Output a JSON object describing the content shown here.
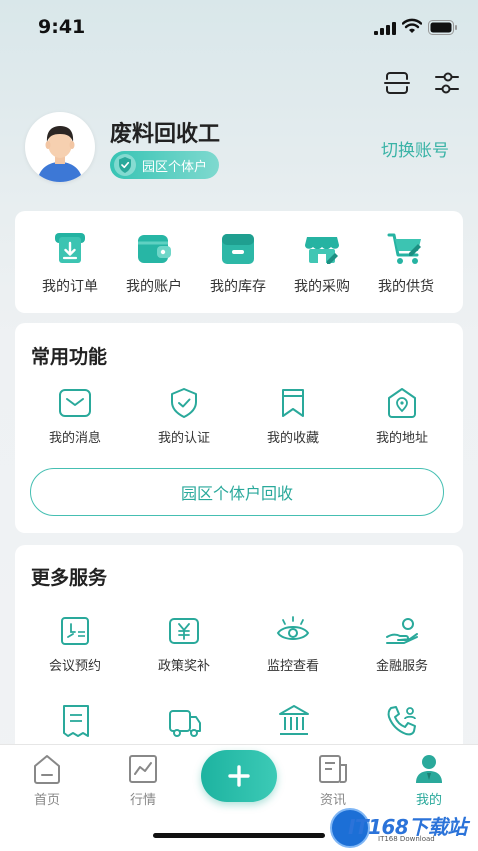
{
  "status": {
    "time": "9:41"
  },
  "profile": {
    "name": "废料回收工",
    "badge": "园区个体户",
    "switch_label": "切换账号"
  },
  "quick": [
    {
      "label": "我的订单",
      "icon": "order-icon"
    },
    {
      "label": "我的账户",
      "icon": "wallet-icon"
    },
    {
      "label": "我的库存",
      "icon": "inventory-icon"
    },
    {
      "label": "我的采购",
      "icon": "store-icon"
    },
    {
      "label": "我的供货",
      "icon": "cart-icon"
    }
  ],
  "common": {
    "title": "常用功能",
    "items": [
      {
        "label": "我的消息",
        "icon": "mail-icon"
      },
      {
        "label": "我的认证",
        "icon": "shield-icon"
      },
      {
        "label": "我的收藏",
        "icon": "bookmark-icon"
      },
      {
        "label": "我的地址",
        "icon": "location-icon"
      }
    ],
    "button": "园区个体户回收"
  },
  "more": {
    "title": "更多服务",
    "items": [
      {
        "label": "会议预约",
        "icon": "meeting-icon"
      },
      {
        "label": "政策奖补",
        "icon": "yuan-icon"
      },
      {
        "label": "监控查看",
        "icon": "eye-icon"
      },
      {
        "label": "金融服务",
        "icon": "finance-icon"
      }
    ]
  },
  "tabs": [
    {
      "label": "首页",
      "icon": "home-icon"
    },
    {
      "label": "行情",
      "icon": "chart-icon"
    },
    {
      "label": "资讯",
      "icon": "news-icon"
    },
    {
      "label": "我的",
      "icon": "user-icon"
    }
  ],
  "watermark": {
    "main": "IT168下载站",
    "sub": "IT168 Download"
  },
  "colors": {
    "accent": "#2aa99b",
    "accent_light": "#45bfb2"
  }
}
